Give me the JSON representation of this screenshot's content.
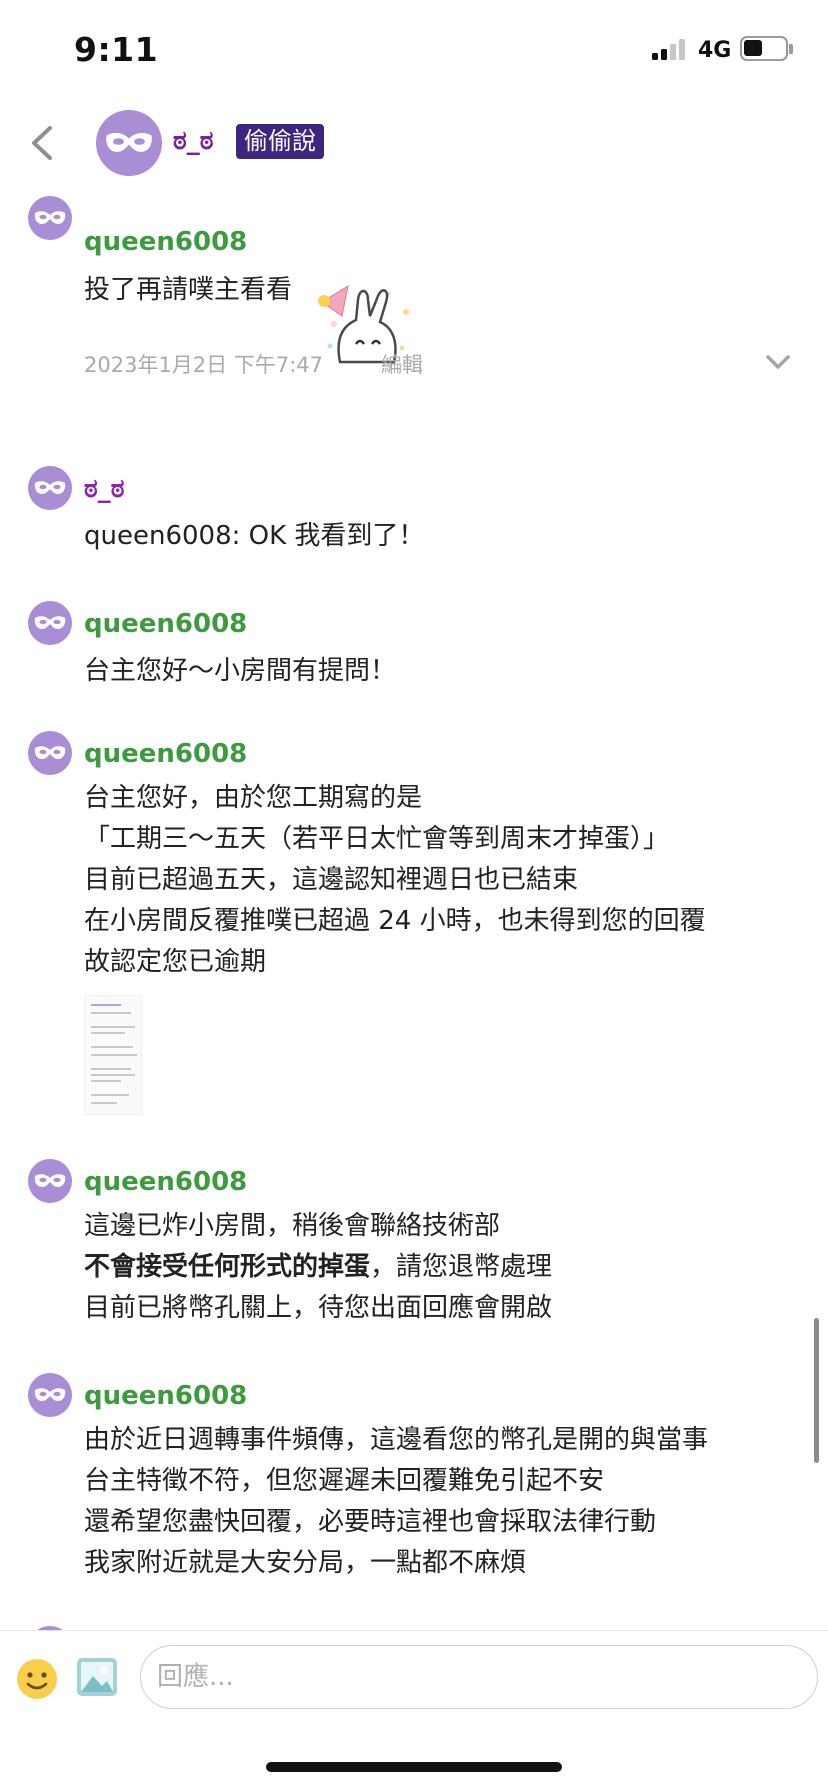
{
  "status_bar": {
    "time": "9:11",
    "network": "4G",
    "battery_level": 0.45
  },
  "header": {
    "name": "ಠ_ಠ",
    "badge": "偷偷說"
  },
  "messages": [
    {
      "author": "queen6008",
      "text": "投了再請噗主看看",
      "sticker": "bunny-party-sticker",
      "timestamp": "2023年1月2日 下午7:47",
      "edit_label": "編輯"
    },
    {
      "author": "ಠ_ಠ",
      "text": "queen6008: OK 我看到了！"
    },
    {
      "author": "queen6008",
      "text": "台主您好～小房間有提問！"
    },
    {
      "author": "queen6008",
      "lines": [
        "台主您好，由於您工期寫的是",
        "「工期三～五天（若平日太忙會等到周末才掉蛋）」",
        "目前已超過五天，這邊認知裡週日也已結束",
        "在小房間反覆推噗已超過 24 小時，也未得到您的回覆",
        "故認定您已逾期"
      ],
      "attachment": "screenshot-thumbnail"
    },
    {
      "author": "queen6008",
      "lines": [
        "這邊已炸小房間，稍後會聯絡技術部",
        "目前已將幣孔關上，待您出面回應會開啟"
      ],
      "bold_part": "不會接受任何形式的掉蛋",
      "rest_part": "，請您退幣處理"
    },
    {
      "author": "queen6008",
      "lines": [
        "由於近日週轉事件頻傳，這邊看您的幣孔是開的與當事",
        "台主特徵不符，但您遲遲未回覆難免引起不安",
        "還希望您盡快回覆，必要時這裡也會採取法律行動",
        "我家附近就是大安分局，一點都不麻煩"
      ]
    }
  ],
  "composer": {
    "placeholder": "回應..."
  },
  "colors": {
    "author_green": "#3e9a3e",
    "author_purple": "#8e24aa",
    "badge_bg": "#3d2680",
    "avatar_bg": "#a98ed6"
  },
  "icons": [
    "back-chevron-icon",
    "mask-avatar-icon",
    "chevron-down-icon",
    "emoji-icon",
    "image-icon"
  ]
}
